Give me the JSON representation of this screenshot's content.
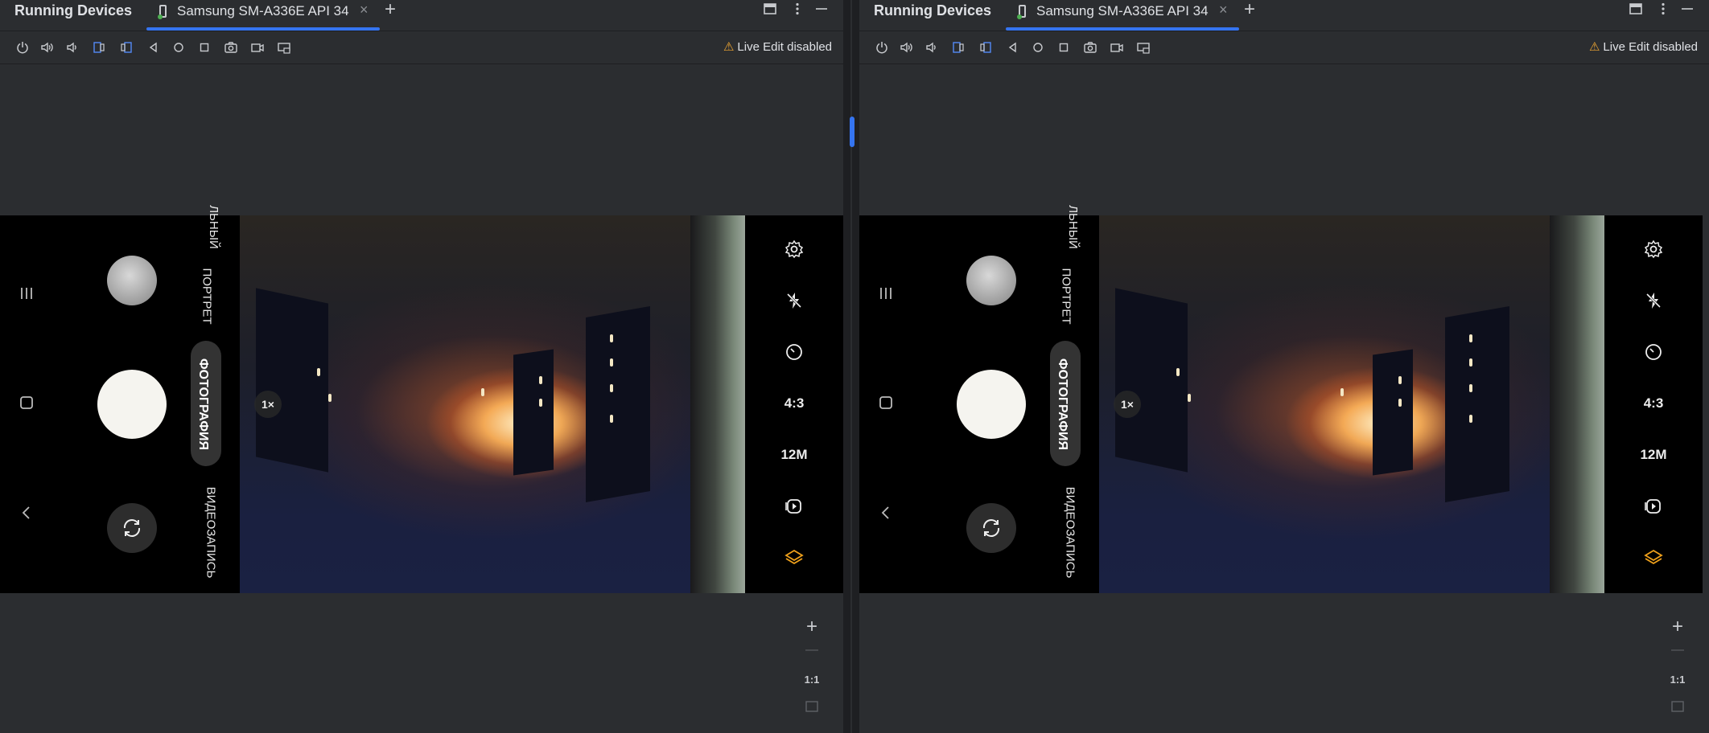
{
  "panels": [
    {
      "window": {
        "title": "Running Devices",
        "tab_label": "Samsung SM-A336E API 34",
        "tab_close": "×",
        "add_tab": "+"
      },
      "toolbar": {
        "live_edit": "Live Edit disabled"
      },
      "camera": {
        "modes": [
          "ПОРТРЕТ",
          "ФОТОГРАФИЯ",
          "ВИДЕОЗАПИСЬ"
        ],
        "mode_partial": "ЛЬНЫЙ",
        "active_mode": "ФОТОГРАФИЯ",
        "zoom": "1×",
        "settings": {
          "ratio": "4:3",
          "resolution": "12M"
        }
      },
      "zoom_controls": {
        "plus": "+",
        "minus": "—",
        "actual": "1:1"
      }
    },
    {
      "window": {
        "title": "Running Devices",
        "tab_label": "Samsung SM-A336E API 34",
        "tab_close": "×",
        "add_tab": "+"
      },
      "toolbar": {
        "live_edit": "Live Edit disabled"
      },
      "camera": {
        "modes": [
          "ПОРТРЕТ",
          "ФОТОГРАФИЯ",
          "ВИДЕОЗАПИСЬ"
        ],
        "mode_partial": "ЛЬНЫЙ",
        "active_mode": "ФОТОГРАФИЯ",
        "zoom": "1×",
        "settings": {
          "ratio": "4:3",
          "resolution": "12M"
        }
      },
      "zoom_controls": {
        "plus": "+",
        "minus": "—",
        "actual": "1:1"
      }
    }
  ],
  "colors": {
    "accent": "#3574f0",
    "background": "#2b2d30",
    "warning": "#f0a732",
    "device_bg": "#000000",
    "layers_icon": "#f0a11b"
  },
  "toolbar_icons": [
    "power-icon",
    "volume-up-icon",
    "volume-down-icon",
    "rotate-left-icon",
    "rotate-right-icon",
    "back-icon",
    "home-icon",
    "overview-icon",
    "screenshot-icon",
    "screen-record-icon",
    "device-settings-icon"
  ]
}
